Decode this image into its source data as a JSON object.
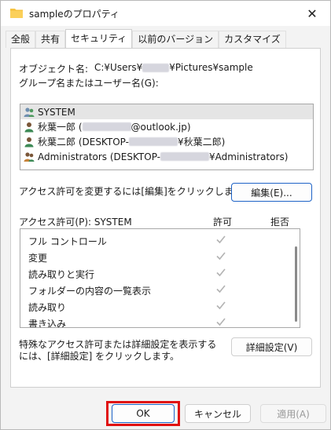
{
  "window": {
    "title": "sampleのプロパティ",
    "close_glyph": "✕"
  },
  "tabs": [
    {
      "label": "全般",
      "active": false
    },
    {
      "label": "共有",
      "active": false
    },
    {
      "label": "セキュリティ",
      "active": true
    },
    {
      "label": "以前のバージョン",
      "active": false
    },
    {
      "label": "カスタマイズ",
      "active": false
    }
  ],
  "security": {
    "object_name_label": "オブジェクト名:",
    "object_path_prefix": "C:¥Users¥",
    "object_path_suffix": "¥Pictures¥sample",
    "group_label": "グループ名またはユーザー名(G):",
    "users": [
      {
        "name": "SYSTEM",
        "icon": "user-group-icon",
        "selected": true
      },
      {
        "name_prefix": "秋葉一郎 (",
        "name_suffix": "@outlook.jp)",
        "icon": "user-icon"
      },
      {
        "name_prefix": "秋葉二郎 (DESKTOP-",
        "name_suffix": "¥秋葉二郎)",
        "icon": "user-icon"
      },
      {
        "name_prefix": "Administrators (DESKTOP-",
        "name_suffix": "¥Administrators)",
        "icon": "user-group-icon"
      }
    ],
    "change_text": "アクセス許可を変更するには[編集]をクリックします。",
    "edit_button": "編集(E)...",
    "perm_header": "アクセス許可(P): SYSTEM",
    "allow_header": "許可",
    "deny_header": "拒否",
    "permissions": [
      {
        "name": "フル コントロール",
        "allow": true
      },
      {
        "name": "変更",
        "allow": true
      },
      {
        "name": "読み取りと実行",
        "allow": true
      },
      {
        "name": "フォルダーの内容の一覧表示",
        "allow": true
      },
      {
        "name": "読み取り",
        "allow": true
      },
      {
        "name": "書き込み",
        "allow": true
      }
    ],
    "advanced_text_1": "特殊なアクセス許可または詳細設定を表示する",
    "advanced_text_2": "には、[詳細設定] をクリックします。",
    "advanced_button": "詳細設定(V)"
  },
  "footer": {
    "ok": "OK",
    "cancel": "キャンセル",
    "apply": "適用(A)"
  },
  "colors": {
    "accent": "#1e63c7",
    "highlight": "#e01010",
    "check": "#b3b3b3"
  }
}
